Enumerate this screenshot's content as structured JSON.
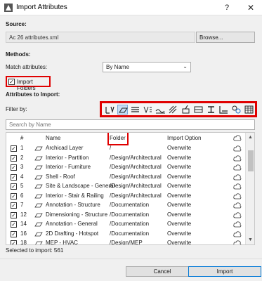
{
  "window": {
    "title": "Import Attributes",
    "help": "?",
    "close": "✕"
  },
  "source": {
    "label": "Source:",
    "value": "Ac 26 attributes.xml",
    "browse": "Browse..."
  },
  "methods": {
    "label": "Methods:",
    "match_label": "Match attributes:",
    "match_value": "By Name",
    "import_folders_label": "Import Folders",
    "import_folders_checked": true
  },
  "attributes": {
    "label": "Attributes to Import:",
    "filter_label": "Filter by:",
    "search_placeholder": "Search by Name",
    "filters": [
      "layer-icon",
      "surface-icon",
      "composite-icon",
      "line-type-icon",
      "pen-icon",
      "fill-icon",
      "pen-set-icon",
      "profile-icon",
      "zone-category-icon",
      "building-material-icon",
      "mep-icon",
      "operation-profile-icon"
    ]
  },
  "table": {
    "headers": {
      "num": "#",
      "name": "Name",
      "folder": "Folder",
      "option": "Import Option"
    },
    "rows": [
      {
        "num": "1",
        "name": "Archicad Layer",
        "folder": "/",
        "option": "Overwrite"
      },
      {
        "num": "2",
        "name": "Interior - Partition",
        "folder": "/Design/Architectural",
        "option": "Overwrite"
      },
      {
        "num": "3",
        "name": "Interior - Furniture",
        "folder": "/Design/Architectural",
        "option": "Overwrite"
      },
      {
        "num": "4",
        "name": "Shell - Roof",
        "folder": "/Design/Architectural",
        "option": "Overwrite"
      },
      {
        "num": "5",
        "name": "Site & Landscape - General",
        "folder": "/Design/Architectural",
        "option": "Overwrite"
      },
      {
        "num": "6",
        "name": "Interior - Stair & Railing",
        "folder": "/Design/Architectural",
        "option": "Overwrite"
      },
      {
        "num": "7",
        "name": "Annotation - Structure",
        "folder": "/Documentation",
        "option": "Overwrite"
      },
      {
        "num": "12",
        "name": "Dimensioning - Structure",
        "folder": "/Documentation",
        "option": "Overwrite"
      },
      {
        "num": "14",
        "name": "Annotation - General",
        "folder": "/Documentation",
        "option": "Overwrite"
      },
      {
        "num": "16",
        "name": "2D Drafting - Hotspot",
        "folder": "/Documentation",
        "option": "Overwrite"
      },
      {
        "num": "18",
        "name": "MEP - HVAC",
        "folder": "/Design/MEP",
        "option": "Overwrite"
      }
    ]
  },
  "status": {
    "selected_text": "Selected to import: 561"
  },
  "footer": {
    "cancel": "Cancel",
    "import": "Import"
  },
  "colors": {
    "highlight": "#e00000",
    "accent": "#0078d7"
  }
}
